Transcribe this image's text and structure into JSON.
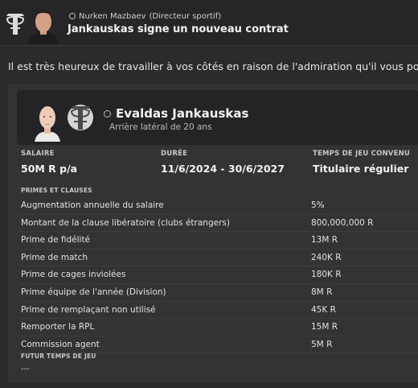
{
  "message": {
    "sender_name": "Nurken Mazbaev",
    "sender_role": "(Directeur sportif)",
    "subject": "Jankauskas signe un nouveau contrat",
    "intro": "Il est très heureux de travailler à vos côtés en raison de l'admiration qu'il vous porte."
  },
  "player": {
    "name": "Evaldas Jankauskas",
    "description": "Arrière latéral de 20 ans"
  },
  "contract": {
    "salary_label": "SALAIRE",
    "salary_value": "50M R p/a",
    "duration_label": "DURÉE",
    "duration_value": "11/6/2024 - 30/6/2027",
    "playtime_label": "TEMPS DE JEU CONVENU",
    "playtime_value": "Titulaire régulier"
  },
  "clauses": {
    "heading": "PRIMES ET CLAUSES",
    "rows": [
      {
        "label": "Augmentation annuelle du salaire",
        "value": "5%"
      },
      {
        "label": "Montant de la clause libératoire (clubs étrangers)",
        "value": "800,000,000 R"
      },
      {
        "label": "Prime de fidélité",
        "value": "13M R"
      },
      {
        "label": "Prime de match",
        "value": "240K R"
      },
      {
        "label": "Prime de cages inviolées",
        "value": "180K R"
      },
      {
        "label": "Prime équipe de l'année (Division)",
        "value": "8M R"
      },
      {
        "label": "Prime de remplaçant non utilisé",
        "value": "45K R"
      },
      {
        "label": "Remporter la RPL",
        "value": "15M R"
      },
      {
        "label": "Commission agent",
        "value": "5M R"
      }
    ]
  },
  "future": {
    "heading": "FUTUR TEMPS DE JEU",
    "value": "---"
  },
  "icons": {
    "club": "club-crest-icon",
    "pin": "pin-icon"
  },
  "colors": {
    "background": "#2b2b2d",
    "panel": "#333335",
    "card": "#242426",
    "text": "#e8e8e8",
    "muted": "#b9b9b9"
  }
}
